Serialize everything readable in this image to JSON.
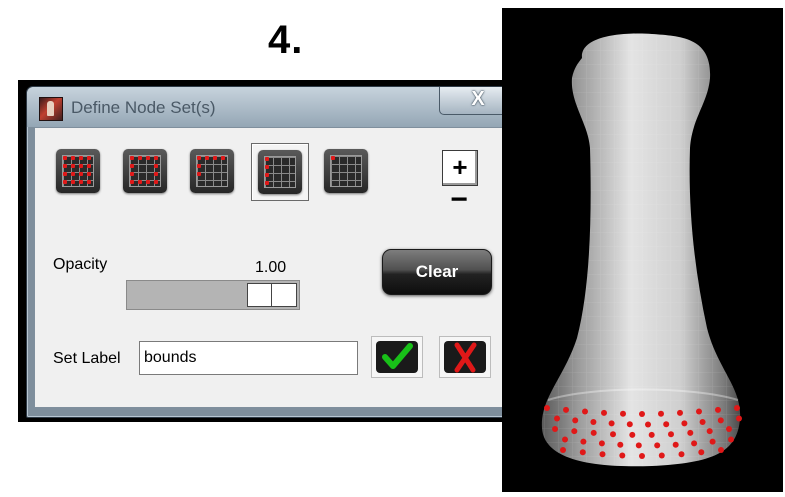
{
  "figure": {
    "step_number": "4."
  },
  "window": {
    "title": "Define Node Set(s)",
    "close_glyph": "X"
  },
  "tools": [
    {
      "name": "all-nodes-tool",
      "icon": "grid-all-nodes-icon"
    },
    {
      "name": "border-nodes-tool",
      "icon": "grid-border-nodes-icon"
    },
    {
      "name": "top-edge-tool",
      "icon": "grid-top-edge-icon"
    },
    {
      "name": "left-edge-tool",
      "icon": "grid-left-edge-icon",
      "selected": true
    },
    {
      "name": "single-node-tool",
      "icon": "grid-single-node-icon"
    }
  ],
  "zoom": {
    "in_glyph": "+",
    "out_glyph": "−"
  },
  "opacity": {
    "label": "Opacity",
    "value_text": "1.00",
    "value": 1.0
  },
  "clear_button": {
    "label": "Clear"
  },
  "set_label": {
    "label": "Set Label",
    "value": "bounds"
  },
  "actions": {
    "confirm_icon": "checkmark-icon",
    "cancel_icon": "red-x-icon"
  },
  "colors": {
    "node_marker": "#e01818",
    "confirm": "#18c018",
    "cancel": "#e01818",
    "render_bg": "#000000"
  }
}
